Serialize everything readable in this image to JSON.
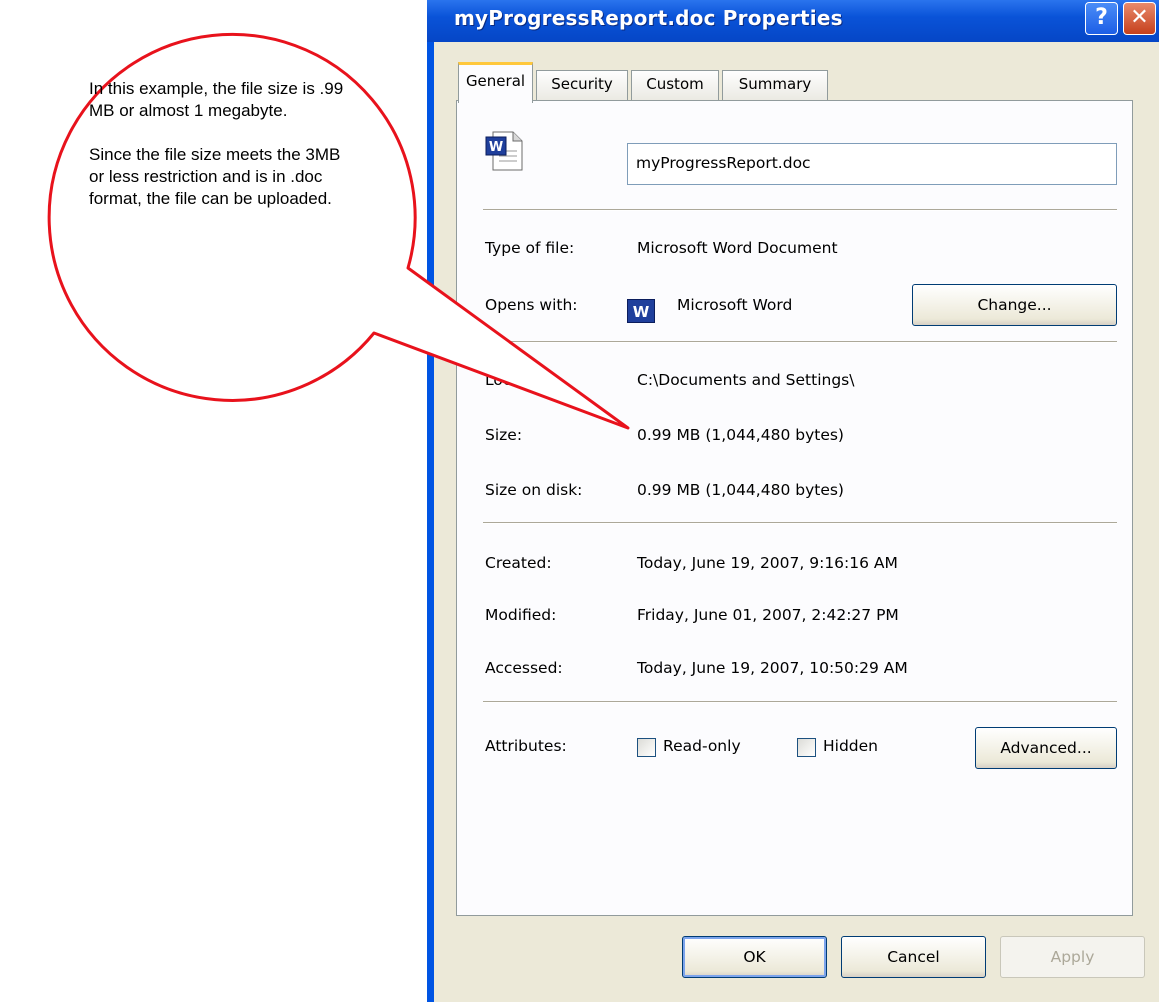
{
  "callout": {
    "paragraph1": "In this example, the file size is .99 MB or almost 1 megabyte.",
    "paragraph2": "Since the file size meets the 3MB or less restriction and is in .doc format, the file can be uploaded.",
    "color": "#e8121c"
  },
  "window": {
    "title": "myProgressReport.doc Properties",
    "help_label": "?",
    "close_label": "✕",
    "titlebar_color": "#0a53d8"
  },
  "tabs": [
    {
      "label": "General",
      "active": true
    },
    {
      "label": "Security",
      "active": false
    },
    {
      "label": "Custom",
      "active": false
    },
    {
      "label": "Summary",
      "active": false
    }
  ],
  "general": {
    "file_icon": "word-document-icon",
    "file_name": "myProgressReport.doc",
    "type_label": "Type of file:",
    "type_value": "Microsoft Word Document",
    "opens_label": "Opens with:",
    "opens_icon": "word-app-icon",
    "opens_value": "Microsoft Word",
    "change_button": "Change...",
    "location_label": "Location:",
    "location_value": "C:\\Documents and Settings\\",
    "size_label": "Size:",
    "size_value": "0.99 MB (1,044,480 bytes)",
    "size_disk_label": "Size on disk:",
    "size_disk_value": "0.99 MB (1,044,480 bytes)",
    "created_label": "Created:",
    "created_value": "Today, June 19, 2007, 9:16:16 AM",
    "modified_label": "Modified:",
    "modified_value": "Friday, June 01, 2007, 2:42:27 PM",
    "accessed_label": "Accessed:",
    "accessed_value": "Today, June 19, 2007, 10:50:29 AM",
    "attributes_label": "Attributes:",
    "readonly_label": "Read-only",
    "readonly_checked": false,
    "hidden_label": "Hidden",
    "hidden_checked": false,
    "advanced_button": "Advanced..."
  },
  "footer": {
    "ok": "OK",
    "cancel": "Cancel",
    "apply": "Apply"
  }
}
